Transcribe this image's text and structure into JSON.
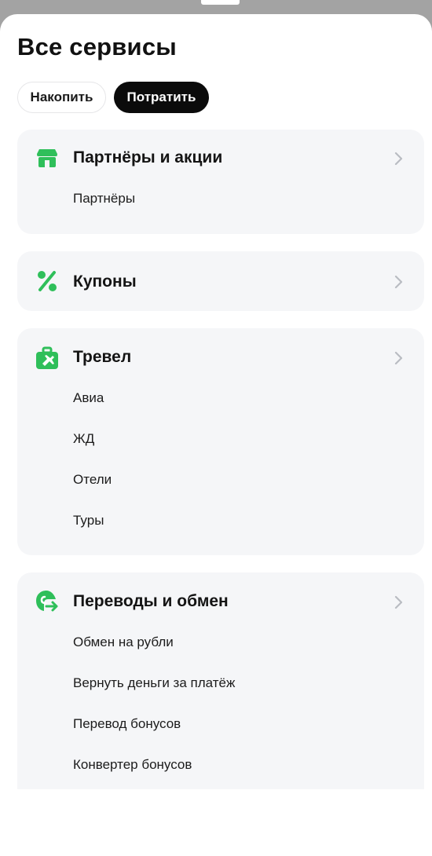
{
  "page": {
    "title": "Все сервисы"
  },
  "segments": {
    "accumulate": "Накопить",
    "spend": "Потратить",
    "active": "spend"
  },
  "colors": {
    "accent": "#2fbf5a",
    "background": "#f5f6f8",
    "active_pill": "#0b0b0b"
  },
  "sections": {
    "partners": {
      "title": "Партнёры и акции",
      "icon": "store-icon",
      "items": [
        "Партнёры"
      ]
    },
    "coupons": {
      "title": "Купоны",
      "icon": "percent-icon",
      "items": []
    },
    "travel": {
      "title": "Тревел",
      "icon": "suitcase-plane-icon",
      "items": [
        "Авиа",
        "ЖД",
        "Отели",
        "Туры"
      ]
    },
    "transfers": {
      "title": "Переводы и обмен",
      "icon": "exchange-icon",
      "items": [
        "Обмен на рубли",
        "Вернуть деньги за платёж",
        "Перевод бонусов",
        "Конвертер бонусов"
      ]
    }
  }
}
